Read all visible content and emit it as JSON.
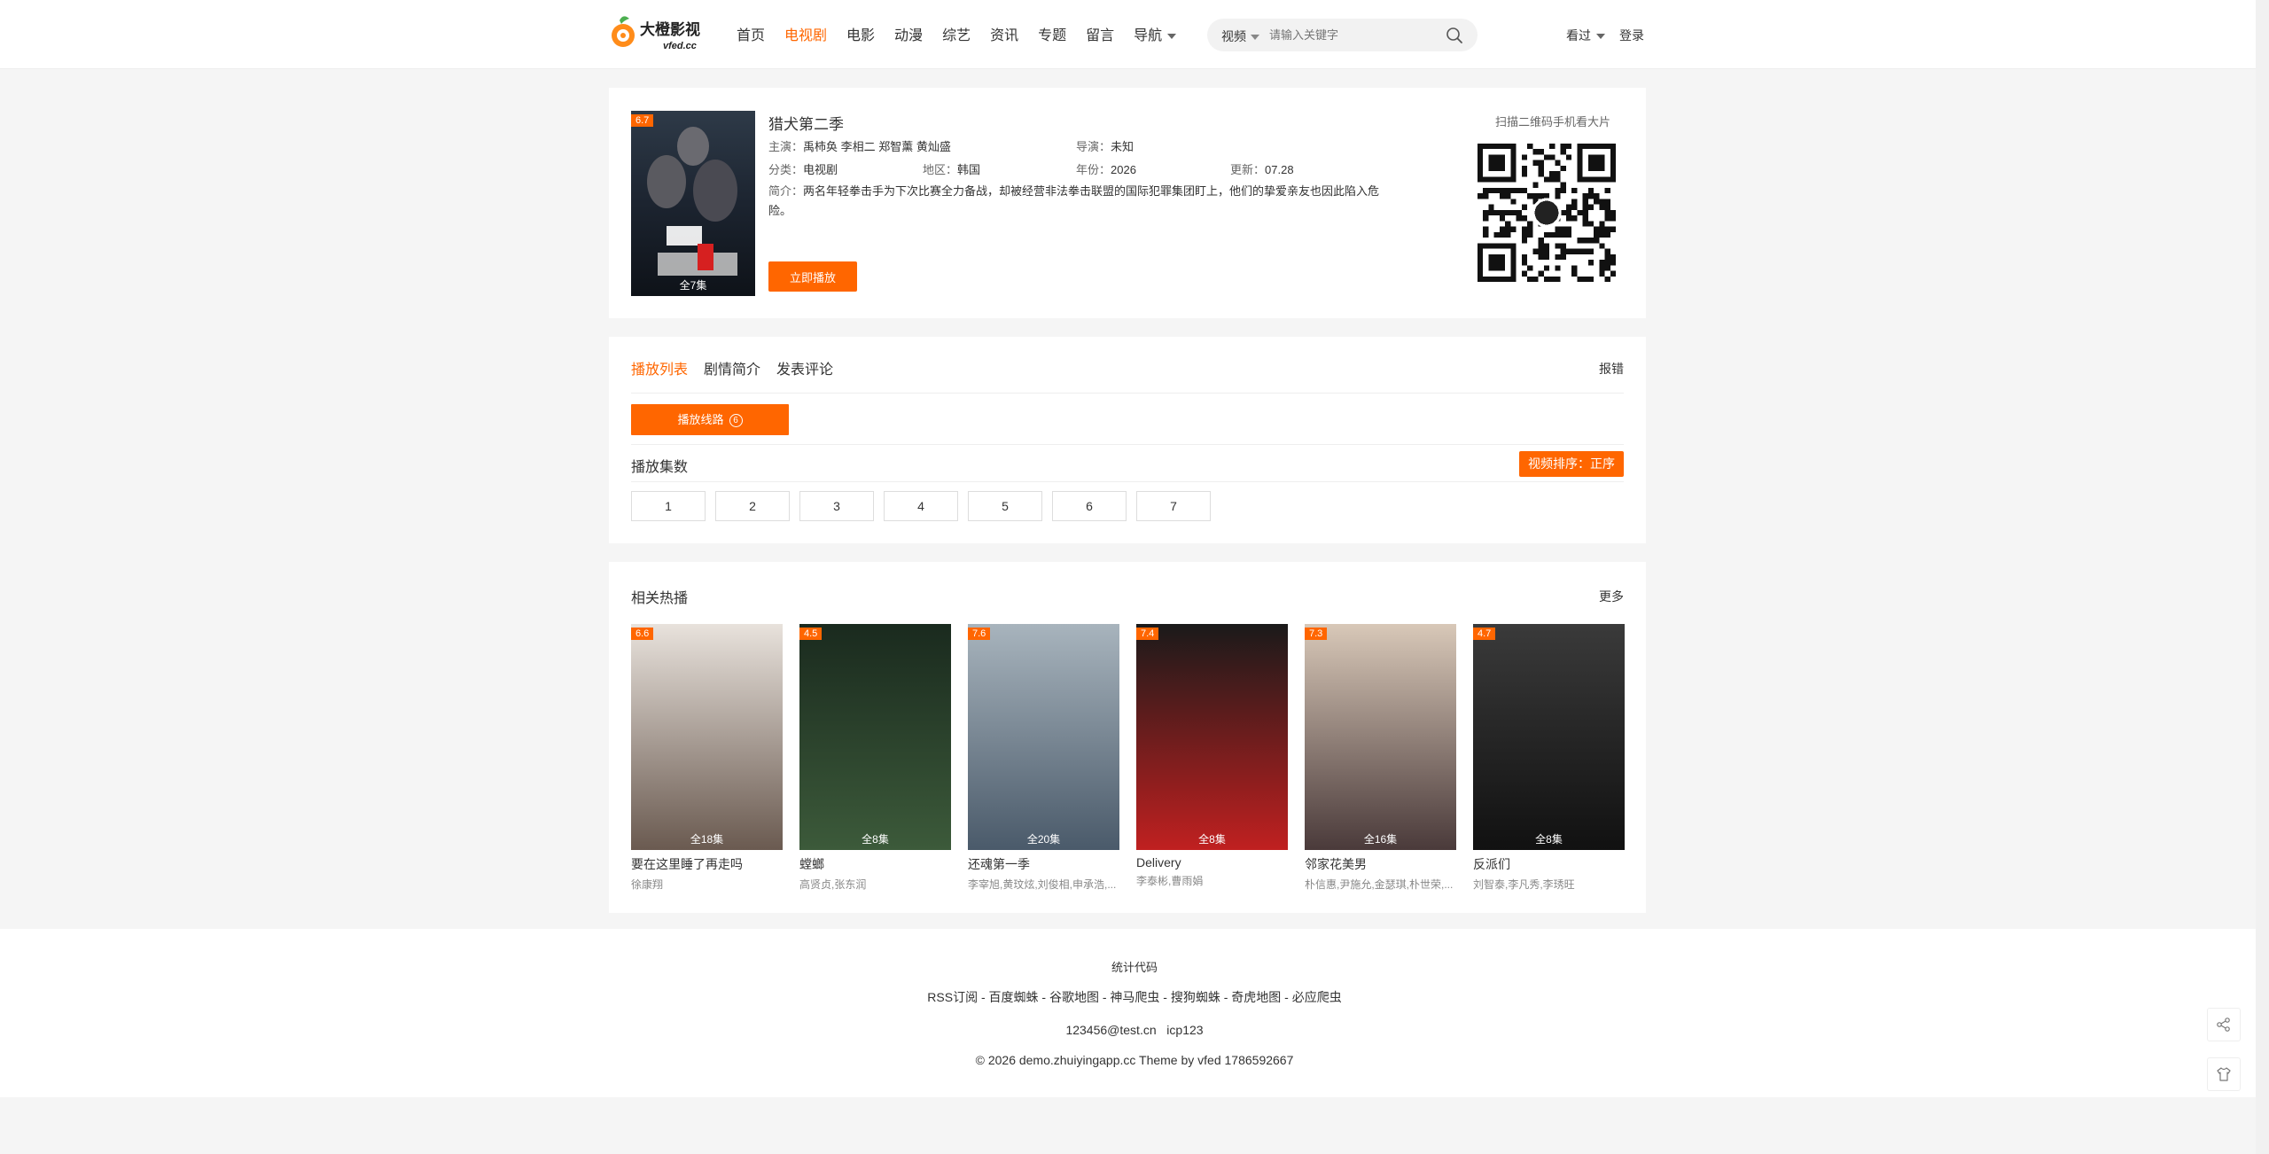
{
  "header": {
    "logo_text": "大橙影视",
    "logo_sub": "vfed.cc",
    "nav": [
      "首页",
      "电视剧",
      "电影",
      "动漫",
      "综艺",
      "资讯",
      "专题",
      "留言",
      "导航"
    ],
    "active_nav": "电视剧",
    "search_type": "视频",
    "search_placeholder": "请输入关键字",
    "history": "看过",
    "login": "登录"
  },
  "detail": {
    "score": "6.7",
    "episodes": "全7集",
    "title": "猎犬第二季",
    "actors_label": "主演：",
    "actors": "禹柿奂 李相二 郑智薰 黄灿盛",
    "director_label": "导演：",
    "director": "未知",
    "category_label": "分类：",
    "category": "电视剧",
    "region_label": "地区：",
    "region": "韩国",
    "year_label": "年份：",
    "year": "2026",
    "update_label": "更新：",
    "update": "07.28",
    "intro_label": "简介：",
    "intro": "两名年轻拳击手为下次比赛全力备战，却被经营非法拳击联盟的国际犯罪集团盯上，他们的挚爱亲友也因此陷入危险。",
    "play_button": "立即播放",
    "qr_label": "扫描二维码手机看大片"
  },
  "playlist": {
    "tabs": [
      "播放列表",
      "剧情简介",
      "发表评论"
    ],
    "active_tab": "播放列表",
    "report": "报错",
    "line_label": "播放线路",
    "line_count": "6",
    "episodes_label": "播放集数",
    "sort_label": "视频排序：正序",
    "episodes": [
      "1",
      "2",
      "3",
      "4",
      "5",
      "6",
      "7"
    ]
  },
  "related": {
    "title": "相关热播",
    "more": "更多",
    "items": [
      {
        "score": "6.6",
        "episodes": "全18集",
        "name": "要在这里睡了再走吗",
        "actors": "徐康翔",
        "color1": "#e8e2dc",
        "color2": "#6a5a50"
      },
      {
        "score": "4.5",
        "episodes": "全8集",
        "name": "螳螂",
        "actors": "高贤贞,张东润",
        "color1": "#1a2a1e",
        "color2": "#3c5a3a"
      },
      {
        "score": "7.6",
        "episodes": "全20集",
        "name": "还魂第一季",
        "actors": "李宰旭,黄玟炫,刘俊相,申承浩,...",
        "color1": "#a8b4bd",
        "color2": "#4a5a6a"
      },
      {
        "score": "7.4",
        "episodes": "全8集",
        "name": "Delivery",
        "actors": "李泰彬,曹雨娟",
        "color1": "#1a1a1a",
        "color2": "#c02020"
      },
      {
        "score": "7.3",
        "episodes": "全16集",
        "name": "邻家花美男",
        "actors": "朴信惠,尹施允,金瑟琪,朴世荣,...",
        "color1": "#d8c8b8",
        "color2": "#4a3a3a"
      },
      {
        "score": "4.7",
        "episodes": "全8集",
        "name": "反派们",
        "actors": "刘智泰,李凡秀,李琇旺",
        "color1": "#3a3a3a",
        "color2": "#111111"
      }
    ]
  },
  "footer": {
    "stats": "统计代码",
    "links": "RSS订阅 - 百度蜘蛛 - 谷歌地图 - 神马爬虫 - 搜狗蜘蛛 - 奇虎地图 - 必应爬虫",
    "contact": "123456@test.cn   icp123",
    "copyright": "© 2026 demo.zhuiyingapp.cc Theme by vfed 1786592667"
  },
  "colors": {
    "accent": "#ff6600"
  }
}
